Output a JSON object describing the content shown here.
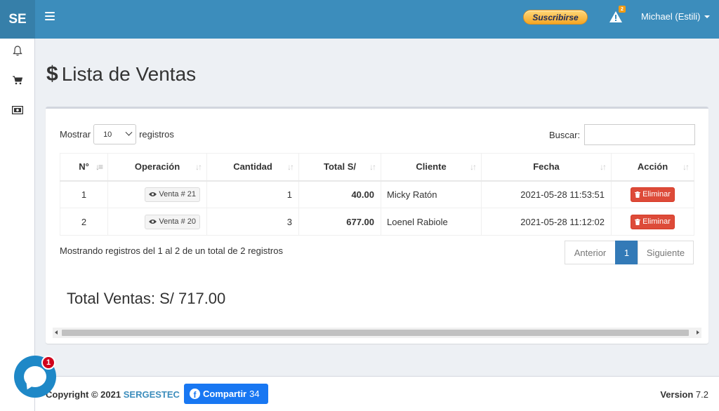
{
  "header": {
    "brand": "SE",
    "subscribe_label": "Suscribirse",
    "alert_count": "2",
    "user_name": "Michael (Estili)"
  },
  "sidebar": {
    "items": [
      {
        "icon": "bell-icon"
      },
      {
        "icon": "shopping-cart-icon"
      },
      {
        "icon": "money-bill-icon"
      }
    ]
  },
  "page": {
    "title": "Lista de Ventas",
    "title_icon": "$"
  },
  "controls": {
    "show_label": "Mostrar",
    "length_value": "10",
    "records_label": "registros",
    "search_label": "Buscar:",
    "search_value": ""
  },
  "table": {
    "columns": [
      "N°",
      "Operación",
      "Cantidad",
      "Total S/",
      "Cliente",
      "Fecha",
      "Acción"
    ],
    "rows": [
      {
        "n": "1",
        "operation": "Venta # 21",
        "quantity": "1",
        "total": "40.00",
        "client": "Micky Ratón",
        "date": "2021-05-28 11:53:51",
        "action": "Eliminar"
      },
      {
        "n": "2",
        "operation": "Venta # 20",
        "quantity": "3",
        "total": "677.00",
        "client": "Loenel Rabiole",
        "date": "2021-05-28 11:12:02",
        "action": "Eliminar"
      }
    ]
  },
  "info_text": "Mostrando registros del 1 al 2 de un total de 2 registros",
  "pagination": {
    "previous": "Anterior",
    "current": "1",
    "next": "Siguiente"
  },
  "total_sales": "Total Ventas: S/ 717.00",
  "footer": {
    "copyright_prefix": "Copyright © 2021",
    "company": "SERGESTEC",
    "share_label": "Compartir",
    "share_count": "34",
    "version_label": "Version",
    "version_number": "7.2"
  },
  "chat": {
    "badge": "1"
  },
  "colors": {
    "header": "#3c8dbc",
    "brand_bg": "#367fa9",
    "danger": "#dd4b39",
    "primary": "#337ab7",
    "facebook": "#1877f2",
    "chat": "#1e88c7"
  }
}
